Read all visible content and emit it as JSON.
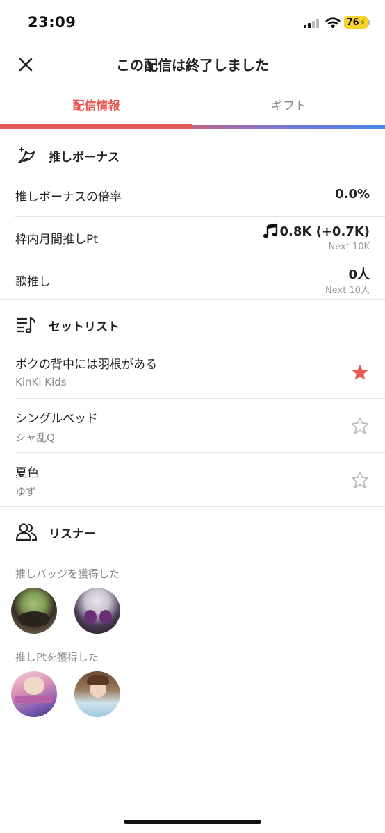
{
  "status_bar": {
    "time": "23:09",
    "battery": "76"
  },
  "header": {
    "title": "この配信は終了しました"
  },
  "tabs": [
    {
      "label": "配信情報",
      "active": true
    },
    {
      "label": "ギフト",
      "active": false
    }
  ],
  "oshi_bonus": {
    "title": "推しボーナス",
    "rows": [
      {
        "label": "推しボーナスの倍率",
        "value": "0.0%"
      },
      {
        "label": "枠内月間推しPt",
        "value": "0.8K (+0.7K)",
        "sub": "Next 10K"
      },
      {
        "label": "歌推し",
        "value": "0人",
        "sub": "Next 10人"
      }
    ]
  },
  "setlist": {
    "title": "セットリスト",
    "songs": [
      {
        "title": "ボクの背中には羽根がある",
        "artist": "KinKi Kids",
        "starred": true
      },
      {
        "title": "シングルベッド",
        "artist": "シャ乱Q",
        "starred": false
      },
      {
        "title": "夏色",
        "artist": "ゆず",
        "starred": false
      }
    ]
  },
  "listeners": {
    "title": "リスナー",
    "badge_caption": "推しバッジを獲得した",
    "pt_caption": "推しPtを獲得した"
  },
  "colors": {
    "accent": "#e8544f",
    "star_active": "#e85a5a",
    "star_inactive": "#bbbbbb"
  },
  "icons": [
    "close-icon",
    "wing-icon",
    "setlist-icon",
    "listeners-icon",
    "music-note-icon",
    "star-icon"
  ]
}
